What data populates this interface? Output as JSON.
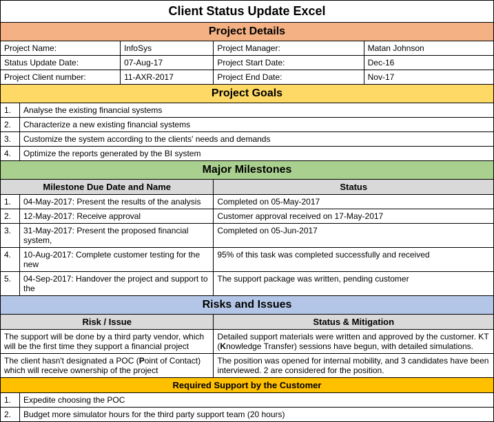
{
  "title": "Client Status Update Excel",
  "sections": {
    "project_details": {
      "header": "Project Details",
      "rows": [
        {
          "label1": "Project Name:",
          "val1": "InfoSys",
          "label2": "Project Manager:",
          "val2": "Matan Johnson"
        },
        {
          "label1": "Status Update Date:",
          "val1": "07-Aug-17",
          "label2": "Project Start Date:",
          "val2": "Dec-16"
        },
        {
          "label1": "Project Client number:",
          "val1": "11-AXR-2017",
          "label2": "Project End Date:",
          "val2": "Nov-17"
        }
      ]
    },
    "project_goals": {
      "header": "Project Goals",
      "items": [
        {
          "num": "1.",
          "text": "Analyse the existing financial systems"
        },
        {
          "num": "2.",
          "text": "Characterize a new existing financial systems"
        },
        {
          "num": "3.",
          "text": "Customize the system according to the clients' needs and demands"
        },
        {
          "num": "4.",
          "text": "Optimize the reports generated by the BI system"
        }
      ]
    },
    "milestones": {
      "header": "Major Milestones",
      "col1": "Milestone Due Date and Name",
      "col2": "Status",
      "items": [
        {
          "num": "1.",
          "name": "04-May-2017: Present the results of the analysis",
          "status": "Completed on 05-May-2017"
        },
        {
          "num": "2.",
          "name": "12-May-2017: Receive approval",
          "status": "Customer approval received on 17-May-2017"
        },
        {
          "num": "3.",
          "name": "31-May-2017: Present the proposed financial system,",
          "status": "Completed on 05-Jun-2017"
        },
        {
          "num": "4.",
          "name": "10-Aug-2017: Complete customer testing for the new",
          "status": "95% of this task was completed successfully and received"
        },
        {
          "num": "5.",
          "name": "04-Sep-2017: Handover the project and support to the",
          "status": "The support package was written, pending customer"
        }
      ]
    },
    "risks": {
      "header": "Risks and Issues",
      "col1": "Risk / Issue",
      "col2": "Status & Mitigation",
      "items": [
        {
          "risk_pre": "The support will be done by a third party vendor, which will be the first time they support a financial project",
          "mit_pre": "Detailed support materials were written and approved by the customer. KT (",
          "mit_bold": "K",
          "mit_mid": "nowledge Transfer) sessions have begun, with detailed simulations."
        },
        {
          "risk_pre2_a": "The client hasn't designated a POC (",
          "risk_pre2_bold": "P",
          "risk_pre2_b": "oint of Contact) which will receive ownership of the project",
          "mit2": "The position was opened for internal mobility, and 3 candidates have been interviewed. 2 are considered for the position."
        }
      ]
    },
    "required_support": {
      "header": "Required Support by the Customer",
      "items": [
        {
          "num": "1.",
          "text": "Expedite choosing the POC"
        },
        {
          "num": "2.",
          "text": "Budget more simulator hours for the third party support team (20 hours)"
        }
      ]
    }
  }
}
